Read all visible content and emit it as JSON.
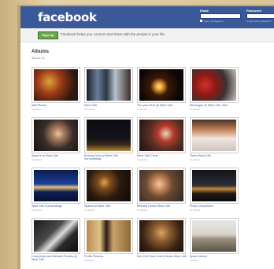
{
  "header": {
    "logo": "facebook",
    "email_label": "Email",
    "password_label": "Password",
    "keep_logged_in": "Keep me logged in",
    "forgot_password": "Forgot your password?"
  },
  "signup": {
    "button": "Sign Up",
    "text": "Facebook helps you connect and share with the people in your life."
  },
  "albums": {
    "title": "Albums",
    "subtitle": "Albums 16",
    "items": [
      {
        "caption": "Wall Photos",
        "count": "3 photos"
      },
      {
        "caption": "West 14th",
        "count": "10 photos"
      },
      {
        "caption": "The year 2010 @ West 14th",
        "count": "11 photos"
      },
      {
        "caption": "Beverages @ West 14th, 2011",
        "count": "11 photos"
      },
      {
        "caption": "Space's at West 14th",
        "count": "10 photos"
      },
      {
        "caption": "Evening View at West 14th Surroundings",
        "count": "10 photos"
      },
      {
        "caption": "West 14th Chefs",
        "count": "10 photos"
      },
      {
        "caption": "Times West 14th",
        "count": "10 photos"
      },
      {
        "caption": "West 14th Surroundings",
        "count": "11 photos"
      },
      {
        "caption": "Spaces at West 14th",
        "count": "11 photos"
      },
      {
        "caption": "Birthday Dinner West 14th",
        "count": "11 photos"
      },
      {
        "caption": "Photo Competition",
        "count": "11 photos"
      },
      {
        "caption": "Coverphoto and Website Preview @ West 14th",
        "count": ""
      },
      {
        "caption": "Profile Pictures",
        "count": "4 photos"
      },
      {
        "caption": "Dec 2010 New Year's Dinner West 14th",
        "count": "11 photos"
      },
      {
        "caption": "Space Interior",
        "count": "1 photo"
      }
    ]
  }
}
